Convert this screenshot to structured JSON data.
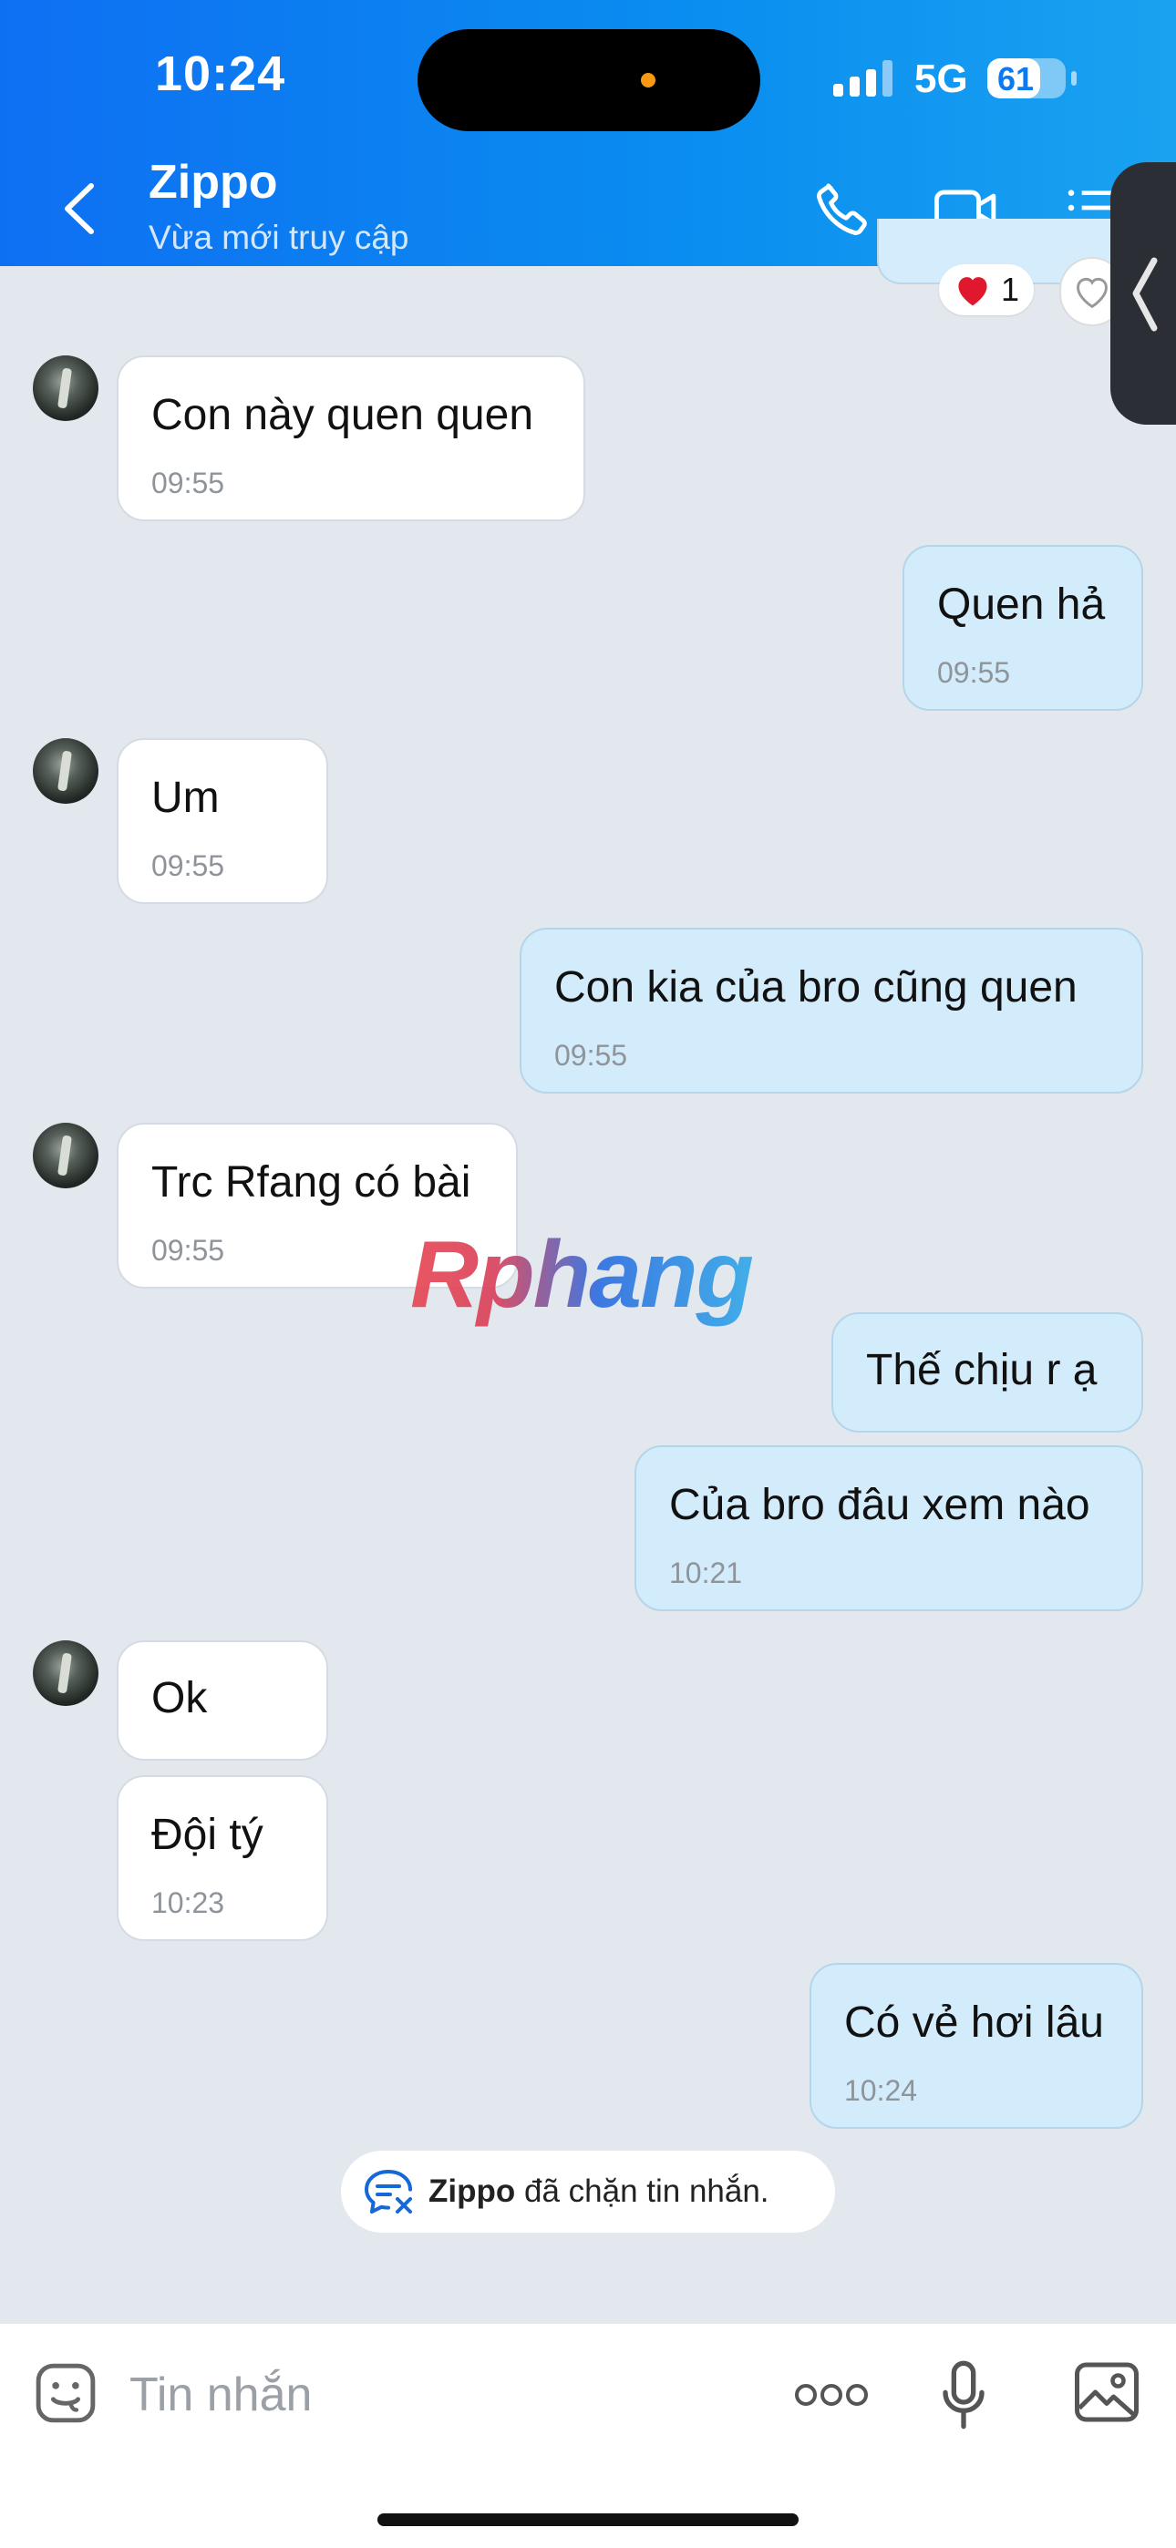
{
  "status_bar": {
    "time": "10:24",
    "network": "5G",
    "battery": "61"
  },
  "header": {
    "title": "Zippo",
    "subtitle": "Vừa mới truy cập"
  },
  "reaction": {
    "count": "1"
  },
  "messages": [
    {
      "side": "in",
      "text": "Con này quen quen",
      "time": "09:55"
    },
    {
      "side": "out",
      "text": "Quen hả",
      "time": "09:55"
    },
    {
      "side": "in",
      "text": "Um",
      "time": "09:55"
    },
    {
      "side": "out",
      "text": "Con kia của bro cũng quen",
      "time": "09:55"
    },
    {
      "side": "in",
      "text": "Trc Rfang có bài",
      "time": "09:55"
    },
    {
      "side": "out",
      "text": "Thế chịu r ạ",
      "time": ""
    },
    {
      "side": "out",
      "text": "Của bro đâu xem nào",
      "time": "10:21"
    },
    {
      "side": "in",
      "text": "Ok",
      "time": ""
    },
    {
      "side": "in",
      "text": "Đội tý",
      "time": "10:23"
    },
    {
      "side": "out",
      "text": "Có vẻ hơi lâu",
      "time": "10:24"
    }
  ],
  "watermark": "Rphang",
  "system_notice": {
    "name": "Zippo",
    "text": "đã chặn tin nhắn."
  },
  "composer": {
    "placeholder": "Tin nhắn"
  },
  "colors": {
    "header": "#0a86f0",
    "bubble_out": "#d3ecfb",
    "bubble_in": "#ffffff",
    "background": "#e3e8ee"
  }
}
